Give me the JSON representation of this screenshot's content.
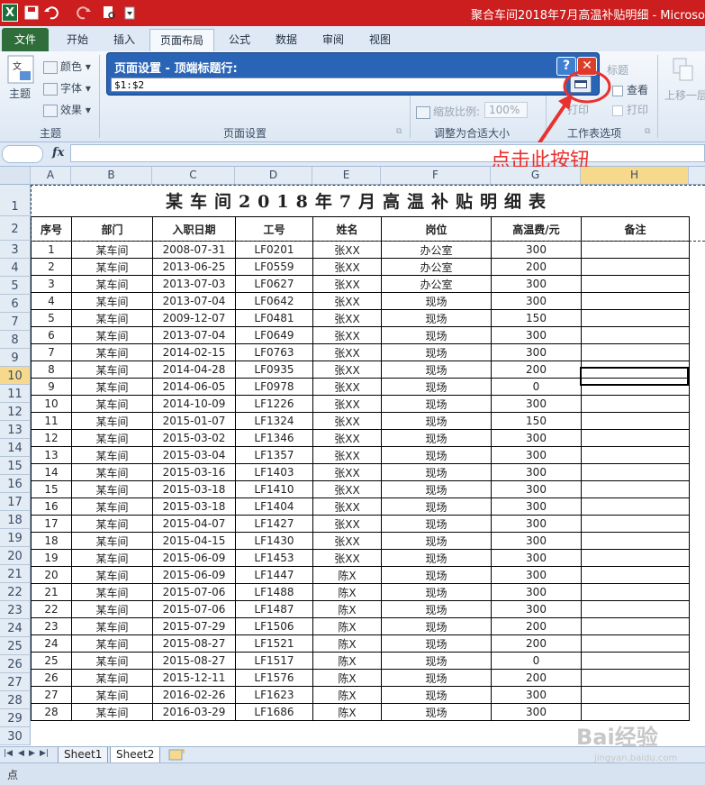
{
  "window": {
    "title": "聚合车间2018年7月高温补贴明细 - Microso",
    "logo": "X"
  },
  "tabs": [
    "文件",
    "开始",
    "插入",
    "页面布局",
    "公式",
    "数据",
    "审阅",
    "视图"
  ],
  "ribbon": {
    "theme_group": "主题",
    "theme_btn": "主题",
    "colors": "颜色",
    "fonts": "字体",
    "effects": "效果",
    "page_setup_group": "页面设置",
    "scale_group": "调整为合适大小",
    "scale_label": "缩放比例:",
    "scale_value": "100%",
    "sheet_options_group": "工作表选项",
    "headings": "标题",
    "view": "查看",
    "print": "打印",
    "print_left": "打印",
    "arrange": "上移一层"
  },
  "dialog": {
    "title": "页面设置 - 顶端标题行:",
    "range_value": "$1:$2",
    "help": "?",
    "close": "✕"
  },
  "formula_bar": {
    "fx": "fx",
    "value": ""
  },
  "columns": [
    "A",
    "B",
    "C",
    "D",
    "E",
    "F",
    "G",
    "H"
  ],
  "selected_column": "H",
  "selected_row": 10,
  "sheet": {
    "title": "某车间2018年7月高温补贴明细表",
    "headers": [
      "序号",
      "部门",
      "入职日期",
      "工号",
      "姓名",
      "岗位",
      "高温费/元",
      "备注"
    ],
    "rows": [
      [
        "1",
        "某车间",
        "2008-07-31",
        "LF0201",
        "张XX",
        "办公室",
        "300",
        ""
      ],
      [
        "2",
        "某车间",
        "2013-06-25",
        "LF0559",
        "张XX",
        "办公室",
        "200",
        ""
      ],
      [
        "3",
        "某车间",
        "2013-07-03",
        "LF0627",
        "张XX",
        "办公室",
        "300",
        ""
      ],
      [
        "4",
        "某车间",
        "2013-07-04",
        "LF0642",
        "张XX",
        "现场",
        "300",
        ""
      ],
      [
        "5",
        "某车间",
        "2009-12-07",
        "LF0481",
        "张XX",
        "现场",
        "150",
        ""
      ],
      [
        "6",
        "某车间",
        "2013-07-04",
        "LF0649",
        "张XX",
        "现场",
        "300",
        ""
      ],
      [
        "7",
        "某车间",
        "2014-02-15",
        "LF0763",
        "张XX",
        "现场",
        "300",
        ""
      ],
      [
        "8",
        "某车间",
        "2014-04-28",
        "LF0935",
        "张XX",
        "现场",
        "200",
        ""
      ],
      [
        "9",
        "某车间",
        "2014-06-05",
        "LF0978",
        "张XX",
        "现场",
        "0",
        ""
      ],
      [
        "10",
        "某车间",
        "2014-10-09",
        "LF1226",
        "张XX",
        "现场",
        "300",
        ""
      ],
      [
        "11",
        "某车间",
        "2015-01-07",
        "LF1324",
        "张XX",
        "现场",
        "150",
        ""
      ],
      [
        "12",
        "某车间",
        "2015-03-02",
        "LF1346",
        "张XX",
        "现场",
        "300",
        ""
      ],
      [
        "13",
        "某车间",
        "2015-03-04",
        "LF1357",
        "张XX",
        "现场",
        "300",
        ""
      ],
      [
        "14",
        "某车间",
        "2015-03-16",
        "LF1403",
        "张XX",
        "现场",
        "300",
        ""
      ],
      [
        "15",
        "某车间",
        "2015-03-18",
        "LF1410",
        "张XX",
        "现场",
        "300",
        ""
      ],
      [
        "16",
        "某车间",
        "2015-03-18",
        "LF1404",
        "张XX",
        "现场",
        "300",
        ""
      ],
      [
        "17",
        "某车间",
        "2015-04-07",
        "LF1427",
        "张XX",
        "现场",
        "300",
        ""
      ],
      [
        "18",
        "某车间",
        "2015-04-15",
        "LF1430",
        "张XX",
        "现场",
        "300",
        ""
      ],
      [
        "19",
        "某车间",
        "2015-06-09",
        "LF1453",
        "张XX",
        "现场",
        "300",
        ""
      ],
      [
        "20",
        "某车间",
        "2015-06-09",
        "LF1447",
        "陈X",
        "现场",
        "300",
        ""
      ],
      [
        "21",
        "某车间",
        "2015-07-06",
        "LF1488",
        "陈X",
        "现场",
        "300",
        ""
      ],
      [
        "22",
        "某车间",
        "2015-07-06",
        "LF1487",
        "陈X",
        "现场",
        "300",
        ""
      ],
      [
        "23",
        "某车间",
        "2015-07-29",
        "LF1506",
        "陈X",
        "现场",
        "200",
        ""
      ],
      [
        "24",
        "某车间",
        "2015-08-27",
        "LF1521",
        "陈X",
        "现场",
        "200",
        ""
      ],
      [
        "25",
        "某车间",
        "2015-08-27",
        "LF1517",
        "陈X",
        "现场",
        "0",
        ""
      ],
      [
        "26",
        "某车间",
        "2015-12-11",
        "LF1576",
        "陈X",
        "现场",
        "200",
        ""
      ],
      [
        "27",
        "某车间",
        "2016-02-26",
        "LF1623",
        "陈X",
        "现场",
        "300",
        ""
      ],
      [
        "28",
        "某车间",
        "2016-03-29",
        "LF1686",
        "陈X",
        "现场",
        "300",
        ""
      ]
    ]
  },
  "sheet_tabs": [
    "Sheet1",
    "Sheet2"
  ],
  "status": "点",
  "annotation": "点击此按钮",
  "watermark": "Bai经验",
  "watermark_url": "jingyan.baidu.com",
  "colors": {
    "titlebar": "#cc1e1e",
    "dialog": "#2a64b7",
    "annotation": "#e8322f",
    "selected_header": "#f7d98d"
  }
}
